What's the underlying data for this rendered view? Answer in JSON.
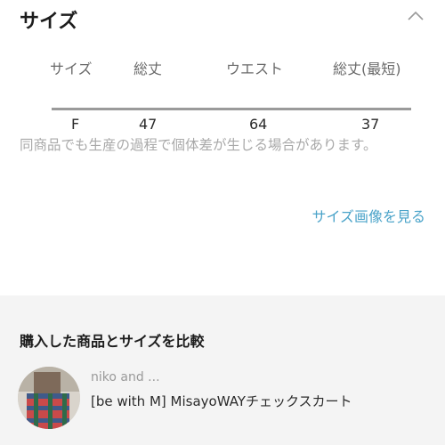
{
  "size_section": {
    "title": "サイズ",
    "table": {
      "headers": [
        "サイズ",
        "総丈",
        "ウエスト",
        "総丈(最短)"
      ],
      "rows": [
        [
          "F",
          "47",
          "64",
          "37"
        ]
      ]
    },
    "note": "同商品でも生産の過程で個体差が生じる場合があります。",
    "size_image_link": "サイズ画像を見る"
  },
  "compare_section": {
    "title": "購入した商品とサイズを比較",
    "item": {
      "brand": "niko and ...",
      "product_name": "[be with M] MisayoWAYチェックスカート"
    }
  },
  "colors": {
    "link": "#4aa3c9",
    "note_text": "#a9a9a9",
    "compare_bg": "#f4f4f4",
    "table_rule": "#9a9a9a"
  }
}
